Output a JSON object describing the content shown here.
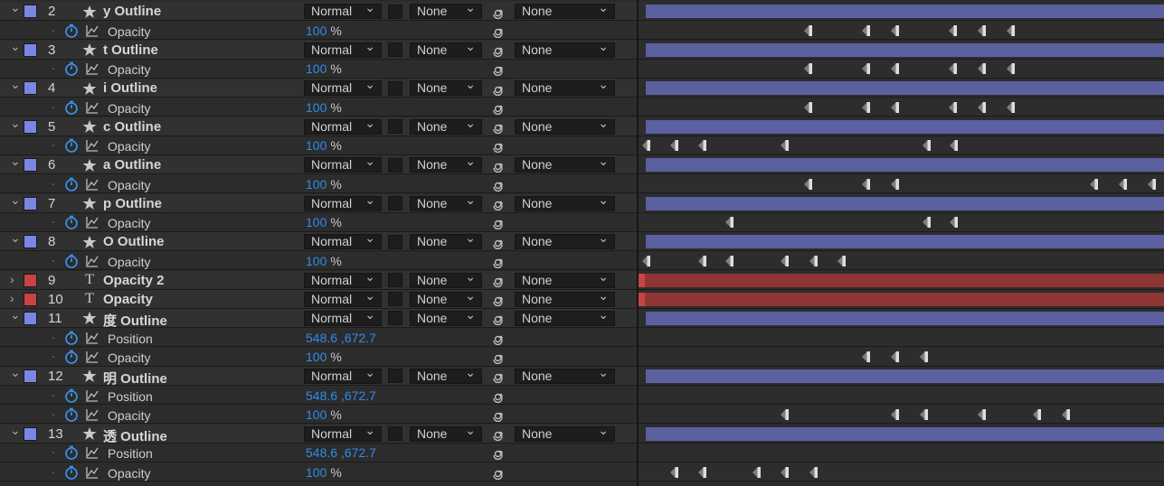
{
  "theme": {
    "blue_label": "#7a86e4",
    "red_label": "#c94343",
    "blue_bar": "#5b60a0",
    "red_bar": "#8f3535",
    "value_blue": "#2d8ceb"
  },
  "icons": {
    "twirl_open": "chevron-down-icon",
    "twirl_closed": "chevron-right-icon",
    "stopwatch": "stopwatch-icon",
    "graph": "graph-icon",
    "parent": "spiral-icon",
    "shape": "star-icon",
    "text": "text-t-icon"
  },
  "rows": [
    {
      "kind": "layer",
      "num": "2",
      "name": "y Outline",
      "type": "shape",
      "label": "blue",
      "mode": "Normal",
      "matte": "None",
      "parent": "None",
      "open": true
    },
    {
      "kind": "prop",
      "name": "Opacity",
      "value": "100",
      "unit": "%",
      "keys": [
        0.325,
        0.435,
        0.49,
        0.6,
        0.655,
        0.71
      ],
      "key_type": "diamond"
    },
    {
      "kind": "layer",
      "num": "3",
      "name": "t Outline",
      "type": "shape",
      "label": "blue",
      "mode": "Normal",
      "matte": "None",
      "parent": "None",
      "open": true
    },
    {
      "kind": "prop",
      "name": "Opacity",
      "value": "100",
      "unit": "%",
      "keys": [
        0.325,
        0.435,
        0.49,
        0.6,
        0.655,
        0.71
      ],
      "key_type": "diamond"
    },
    {
      "kind": "layer",
      "num": "4",
      "name": "i Outline",
      "type": "shape",
      "label": "blue",
      "mode": "Normal",
      "matte": "None",
      "parent": "None",
      "open": true
    },
    {
      "kind": "prop",
      "name": "Opacity",
      "value": "100",
      "unit": "%",
      "keys": [
        0.325,
        0.435,
        0.49,
        0.6,
        0.655,
        0.71
      ],
      "key_type": "diamond"
    },
    {
      "kind": "layer",
      "num": "5",
      "name": "c Outline",
      "type": "shape",
      "label": "blue",
      "mode": "Normal",
      "matte": "None",
      "parent": "None",
      "open": true
    },
    {
      "kind": "prop",
      "name": "Opacity",
      "value": "100",
      "unit": "%",
      "keys": [
        0.017,
        0.07,
        0.124,
        0.281,
        0.55,
        0.603
      ],
      "key_type": "diamond"
    },
    {
      "kind": "layer",
      "num": "6",
      "name": "a Outline",
      "type": "shape",
      "label": "blue",
      "mode": "Normal",
      "matte": "None",
      "parent": "None",
      "open": true
    },
    {
      "kind": "prop",
      "name": "Opacity",
      "value": "100",
      "unit": "%",
      "keys": [
        0.325,
        0.435,
        0.49,
        0.87,
        0.925,
        0.98
      ],
      "key_type": "diamond"
    },
    {
      "kind": "layer",
      "num": "7",
      "name": "p Outline",
      "type": "shape",
      "label": "blue",
      "mode": "Normal",
      "matte": "None",
      "parent": "None",
      "open": true
    },
    {
      "kind": "prop",
      "name": "Opacity",
      "value": "100",
      "unit": "%",
      "keys": [
        0.176,
        0.55,
        0.603
      ],
      "key_type": "diamond"
    },
    {
      "kind": "layer",
      "num": "8",
      "name": "O Outline",
      "type": "shape",
      "label": "blue",
      "mode": "Normal",
      "matte": "None",
      "parent": "None",
      "open": true
    },
    {
      "kind": "prop",
      "name": "Opacity",
      "value": "100",
      "unit": "%",
      "keys": [
        0.017,
        0.124,
        0.176,
        0.281,
        0.335,
        0.389
      ],
      "key_type": "diamond"
    },
    {
      "kind": "layer",
      "num": "9",
      "name": "Opacity 2",
      "type": "text",
      "label": "red",
      "mode": "Normal",
      "matte": "None",
      "parent": "None",
      "open": false
    },
    {
      "kind": "layer",
      "num": "10",
      "name": "Opacity",
      "type": "text",
      "label": "red",
      "mode": "Normal",
      "matte": "None",
      "parent": "None",
      "open": false
    },
    {
      "kind": "layer",
      "num": "11",
      "name": "度 Outline",
      "type": "shape",
      "label": "blue",
      "mode": "Normal",
      "matte": "None",
      "parent": "None",
      "open": true
    },
    {
      "kind": "prop",
      "name": "Position",
      "value": "548.6 ,672.7",
      "unit": "",
      "keys": [],
      "key_type": "diamond"
    },
    {
      "kind": "prop",
      "name": "Opacity",
      "value": "100",
      "unit": "%",
      "keys": [
        0.435,
        0.49,
        0.545
      ],
      "key_type": "diamond"
    },
    {
      "kind": "layer",
      "num": "12",
      "name": "明 Outline",
      "type": "shape",
      "label": "blue",
      "mode": "Normal",
      "matte": "None",
      "parent": "None",
      "open": true
    },
    {
      "kind": "prop",
      "name": "Position",
      "value": "548.6 ,672.7",
      "unit": "",
      "keys": [],
      "key_type": "diamond"
    },
    {
      "kind": "prop",
      "name": "Opacity",
      "value": "100",
      "unit": "%",
      "keys": [
        0.281,
        0.49,
        0.545,
        0.655,
        0.76,
        0.815
      ],
      "key_type": "diamond"
    },
    {
      "kind": "layer",
      "num": "13",
      "name": "透 Outline",
      "type": "shape",
      "label": "blue",
      "mode": "Normal",
      "matte": "None",
      "parent": "None",
      "open": true
    },
    {
      "kind": "prop",
      "name": "Position",
      "value": "548.6 ,672.7",
      "unit": "",
      "keys": [],
      "key_type": "diamond"
    },
    {
      "kind": "prop",
      "name": "Opacity",
      "value": "100",
      "unit": "%",
      "keys": [
        0.07,
        0.124,
        0.228,
        0.281,
        0.335
      ],
      "key_type": "diamond"
    }
  ]
}
